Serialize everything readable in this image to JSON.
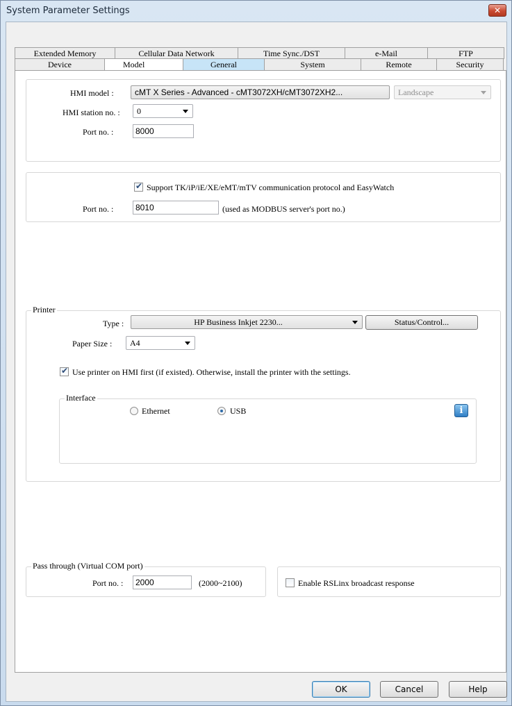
{
  "window": {
    "title": "System Parameter Settings",
    "close_glyph": "✕"
  },
  "tabs": {
    "row1": [
      "Extended Memory",
      "Cellular Data Network",
      "Time Sync./DST",
      "e-Mail",
      "FTP"
    ],
    "row2": [
      "Device",
      "Model",
      "General",
      "System",
      "Remote",
      "Security"
    ],
    "active": "Model",
    "hover": "General"
  },
  "model": {
    "hmi_model_label": "HMI model :",
    "hmi_model_value": "cMT X Series - Advanced - cMT3072XH/cMT3072XH2...",
    "orientation_value": "Landscape",
    "station_label": "HMI station no. :",
    "station_value": "0",
    "port_label": "Port no. :",
    "port_value": "8000"
  },
  "protocol": {
    "support_label": "Support TK/iP/iE/XE/eMT/mTV communication protocol and EasyWatch",
    "support_checked": true,
    "port_label": "Port no. :",
    "port_value": "8010",
    "port_note": "(used as MODBUS server's port no.)"
  },
  "printer": {
    "legend": "Printer",
    "type_label": "Type :",
    "type_value": "HP Business Inkjet 2230...",
    "status_button": "Status/Control...",
    "paper_label": "Paper Size :",
    "paper_value": "A4",
    "use_hmi_label": "Use printer on HMI first (if existed). Otherwise, install the printer with the settings.",
    "use_hmi_checked": true,
    "interface_legend": "Interface",
    "ethernet_label": "Ethernet",
    "usb_label": "USB",
    "selected_interface": "USB",
    "info_glyph": "i"
  },
  "pass_through": {
    "legend": "Pass through (Virtual COM port)",
    "port_label": "Port no. :",
    "port_value": "2000",
    "range_note": "(2000~2100)",
    "rslinx_label": "Enable RSLinx broadcast response",
    "rslinx_checked": false
  },
  "buttons": {
    "ok": "OK",
    "cancel": "Cancel",
    "help": "Help"
  },
  "check_glyph": "✔"
}
